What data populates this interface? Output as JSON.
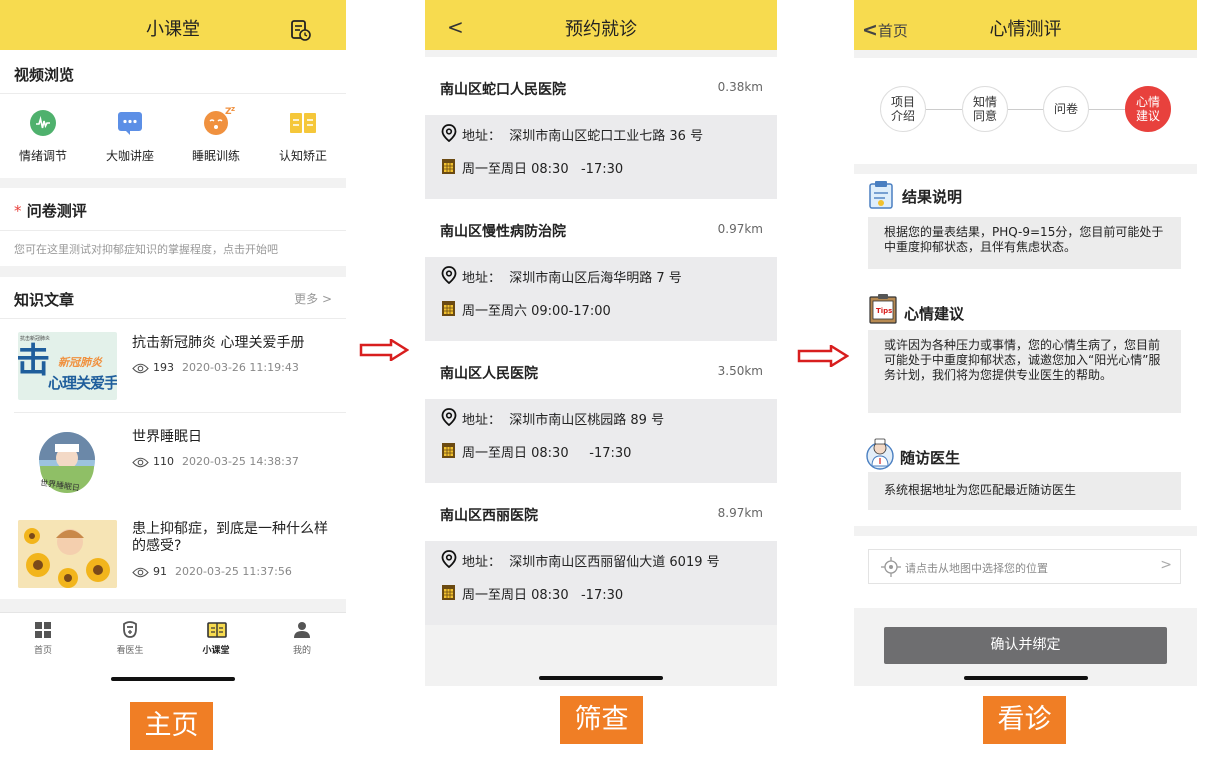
{
  "screen1": {
    "title": "小课堂",
    "video": {
      "title": "视频浏览",
      "items": [
        "情绪调节",
        "大咖讲座",
        "睡眠训练",
        "认知矫正"
      ]
    },
    "survey": {
      "required_mark": "*",
      "title": "问卷测评",
      "desc": "您可在这里测试对抑郁症知识的掌握程度，点击开始吧"
    },
    "articles_section": {
      "title": "知识文章",
      "more": "更多"
    },
    "articles": [
      {
        "title": "抗击新冠肺炎 心理关爱手册",
        "views": "193",
        "date": "2020-03-26 11:19:43",
        "thumb_top": "抗击新冠肺炎",
        "thumb_mid": "新冠肺炎",
        "thumb_main": "心理关爱手",
        "thumb_big": "击"
      },
      {
        "title": "世界睡眠日",
        "views": "110",
        "date": "2020-03-25 14:38:37",
        "thumb_text": "世界睡眠日"
      },
      {
        "title": "患上抑郁症，到底是一种什么样的感受?",
        "views": "91",
        "date": "2020-03-25 11:37:56"
      }
    ],
    "tabs": [
      "首页",
      "看医生",
      "小课堂",
      "我的"
    ],
    "active_tab": "小课堂",
    "caption": "主页"
  },
  "screen2": {
    "title": "预约就诊",
    "back": "<",
    "hospitals": [
      {
        "name": "南山区蛇口人民医院",
        "distance": "0.38km",
        "address": "地址：  深圳市南山区蛇口工业七路 36 号",
        "hours": "周一至周日 08:30   -17:30"
      },
      {
        "name": "南山区慢性病防治院",
        "distance": "0.97km",
        "address": "地址：  深圳市南山区后海华明路 7 号",
        "hours": "周一至周六 09:00-17:00"
      },
      {
        "name": "南山区人民医院",
        "distance": "3.50km",
        "address": "地址：  深圳市南山区桃园路 89 号",
        "hours": "周一至周日 08:30     -17:30"
      },
      {
        "name": "南山区西丽医院",
        "distance": "8.97km",
        "address": "地址：  深圳市南山区西丽留仙大道 6019 号",
        "hours": "周一至周日 08:30   -17:30"
      }
    ],
    "caption": "筛查"
  },
  "screen3": {
    "back_label": "首页",
    "title": "心情测评",
    "steps": [
      {
        "l1": "项目",
        "l2": "介绍"
      },
      {
        "l1": "知情",
        "l2": "同意"
      },
      {
        "l1": "问卷",
        "l2": ""
      },
      {
        "l1": "心情",
        "l2": "建议"
      }
    ],
    "result": {
      "title": "结果说明",
      "text": "根据您的量表结果，PHQ-9=15分，您目前可能处于中重度抑郁状态，且伴有焦虑状态。"
    },
    "advice": {
      "title": "心情建议",
      "icon_text": "Tips",
      "text": "或许因为各种压力或事情，您的心情生病了，您目前可能处于中重度抑郁状态，诚邀您加入“阳光心情”服务计划，我们将为您提供专业医生的帮助。"
    },
    "doctor": {
      "title": "随访医生",
      "text": "系统根据地址为您匹配最近随访医生"
    },
    "location_placeholder": "请点击从地图中选择您的位置",
    "confirm_button": "确认并绑定",
    "caption": "看诊"
  },
  "colors": {
    "header_yellow": "#f7db4f",
    "caption_orange": "#f07e25",
    "active_step_red": "#e8413d",
    "arrow_red": "#d81e1e",
    "button_gray": "#6e6e70"
  }
}
